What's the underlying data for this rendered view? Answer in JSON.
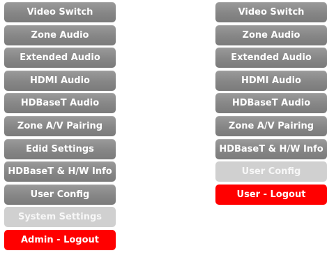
{
  "colors": {
    "normal": "#888888",
    "active": "#d0d0d0",
    "logout": "#ff0000",
    "text": "#ffffff"
  },
  "admin_menu": {
    "items": [
      {
        "label": "Video Switch",
        "state": "normal"
      },
      {
        "label": "Zone Audio",
        "state": "normal"
      },
      {
        "label": "Extended Audio",
        "state": "normal"
      },
      {
        "label": "HDMI Audio",
        "state": "normal"
      },
      {
        "label": "HDBaseT Audio",
        "state": "normal"
      },
      {
        "label": "Zone A/V Pairing",
        "state": "normal"
      },
      {
        "label": "Edid Settings",
        "state": "normal"
      },
      {
        "label": "HDBaseT & H/W Info",
        "state": "normal"
      },
      {
        "label": "User Config",
        "state": "normal"
      },
      {
        "label": "System Settings",
        "state": "active"
      },
      {
        "label": "Admin - Logout",
        "state": "logout"
      }
    ]
  },
  "user_menu": {
    "items": [
      {
        "label": "Video Switch",
        "state": "normal"
      },
      {
        "label": "Zone Audio",
        "state": "normal"
      },
      {
        "label": "Extended Audio",
        "state": "normal"
      },
      {
        "label": "HDMI Audio",
        "state": "normal"
      },
      {
        "label": "HDBaseT Audio",
        "state": "normal"
      },
      {
        "label": "Zone A/V Pairing",
        "state": "normal"
      },
      {
        "label": "HDBaseT & H/W Info",
        "state": "normal"
      },
      {
        "label": "User Config",
        "state": "active"
      },
      {
        "label": "User - Logout",
        "state": "logout"
      }
    ]
  }
}
